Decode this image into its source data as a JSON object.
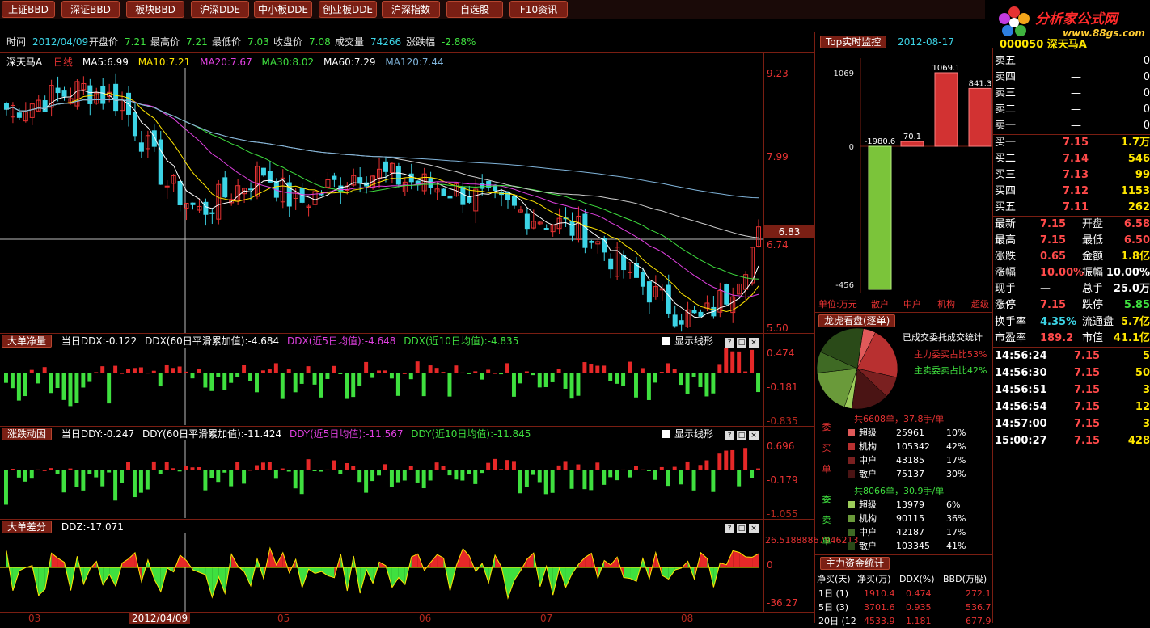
{
  "toolbar": {
    "buttons": [
      "上证BBD",
      "深证BBD",
      "板块BBD",
      "沪深DDE",
      "中小板DDE",
      "创业板DDE",
      "沪深指数",
      "自选股",
      "F10资讯"
    ]
  },
  "logo": {
    "title": "分析家公式网",
    "url": "www.88gs.com"
  },
  "info": {
    "time_label": "时间",
    "time": "2012/04/09",
    "open_label": "开盘价",
    "open": "7.21",
    "high_label": "最高价",
    "high": "7.21",
    "low_label": "最低价",
    "low": "7.03",
    "close_label": "收盘价",
    "close": "7.08",
    "volume_label": "成交量",
    "volume": "74266",
    "change_label": "涨跌幅",
    "change": "-2.88%"
  },
  "kline": {
    "name": "深天马A",
    "period": "日线",
    "ma5": "MA5:6.99",
    "ma10": "MA10:7.21",
    "ma20": "MA20:7.67",
    "ma30": "MA30:8.02",
    "ma60": "MA60:7.29",
    "ma120": "MA120:7.44",
    "axis": [
      "9.23",
      "7.99",
      "6.74",
      "5.50"
    ],
    "current_price": "6.83",
    "colors": {
      "ma5": "#ffffff",
      "ma10": "#ffe600",
      "ma20": "#e040e0",
      "ma30": "#3fe03f",
      "ma60": "#cccccc",
      "ma120": "#7fb3d9",
      "up": "#e63232",
      "down": "#3cd4e6"
    }
  },
  "ddx": {
    "tag": "大单净量",
    "today": "当日DDX:-0.122",
    "acc": "DDX(60日平滑累加值):-4.684",
    "ma5": "DDX(近5日均值):-4.648",
    "ma10": "DDX(近10日均值):-4.835",
    "show": "显示线形",
    "axis": [
      "0.474",
      "-0.181",
      "-0.835"
    ]
  },
  "ddy": {
    "tag": "涨跌动因",
    "today": "当日DDY:-0.247",
    "acc": "DDY(60日平滑累加值):-11.424",
    "ma5": "DDY(近5日均值):-11.567",
    "ma10": "DDY(近10日均值):-11.845",
    "show": "显示线形",
    "axis": [
      "0.696",
      "-0.179",
      "-1.055"
    ]
  },
  "ddz": {
    "tag": "大单差分",
    "today": "DDZ:-17.071",
    "axis_top": "26.51888867946213",
    "axis_mid": "0",
    "axis_bot": "-36.27"
  },
  "xaxis": {
    "labels": [
      "03",
      "2012/04/09",
      "05",
      "06",
      "07",
      "08"
    ]
  },
  "top_monitor": {
    "tag": "Top实时监控",
    "date": "2012-08-17",
    "ytop": "1069",
    "yzero": "0",
    "ybot": "-456",
    "bars": [
      {
        "label": "散户",
        "value": -1980.6
      },
      {
        "label": "中户",
        "value": 70.1
      },
      {
        "label": "机构",
        "value": 1069.1
      },
      {
        "label": "超级",
        "value": 841.3
      }
    ],
    "unit": "单位:万元"
  },
  "lhb": {
    "tag": "龙虎看盘(逐单)",
    "title": "已成交委托成交统计",
    "buy_ratio": "主力委买占比53%",
    "sell_ratio": "主卖委卖占比42%",
    "buy_side": "委买单",
    "sell_side": "委卖单",
    "buy_total": "共6608单，37.8手/单",
    "sell_total": "共8066单，30.9手/单",
    "buy_rows": [
      {
        "name": "超级",
        "count": "25961",
        "pct": "10%"
      },
      {
        "name": "机构",
        "count": "105342",
        "pct": "42%"
      },
      {
        "name": "中户",
        "count": "43185",
        "pct": "17%"
      },
      {
        "name": "散户",
        "count": "75137",
        "pct": "30%"
      }
    ],
    "sell_rows": [
      {
        "name": "超级",
        "count": "13979",
        "pct": "6%"
      },
      {
        "name": "机构",
        "count": "90115",
        "pct": "36%"
      },
      {
        "name": "中户",
        "count": "42187",
        "pct": "17%"
      },
      {
        "name": "散户",
        "count": "103345",
        "pct": "41%"
      }
    ]
  },
  "capital": {
    "tag": "主力资金统计",
    "headers": [
      "净买(天)",
      "净买(万)",
      "DDX(%)",
      "BBD(万股)"
    ],
    "rows": [
      [
        "1日 (1)",
        "1910.4",
        "0.474",
        "272.1"
      ],
      [
        "5日 (3)",
        "3701.6",
        "0.935",
        "536.7"
      ],
      [
        "20日 (12",
        "4533.9",
        "1.181",
        "677.9"
      ]
    ]
  },
  "quote": {
    "header": "000050 深天马A",
    "sell": [
      {
        "label": "卖五",
        "price": "—",
        "vol": "0"
      },
      {
        "label": "卖四",
        "price": "—",
        "vol": "0"
      },
      {
        "label": "卖三",
        "price": "—",
        "vol": "0"
      },
      {
        "label": "卖二",
        "price": "—",
        "vol": "0"
      },
      {
        "label": "卖一",
        "price": "—",
        "vol": "0"
      }
    ],
    "buy": [
      {
        "label": "买一",
        "price": "7.15",
        "vol": "1.7万"
      },
      {
        "label": "买二",
        "price": "7.14",
        "vol": "546"
      },
      {
        "label": "买三",
        "price": "7.13",
        "vol": "99"
      },
      {
        "label": "买四",
        "price": "7.12",
        "vol": "1153"
      },
      {
        "label": "买五",
        "price": "7.11",
        "vol": "262"
      }
    ],
    "stats": [
      {
        "l1": "最新",
        "v1": "7.15",
        "l2": "开盘",
        "v2": "6.58"
      },
      {
        "l1": "最高",
        "v1": "7.15",
        "l2": "最低",
        "v2": "6.50"
      },
      {
        "l1": "涨跌",
        "v1": "0.65",
        "l2": "金额",
        "v2": "1.8亿"
      },
      {
        "l1": "涨幅",
        "v1": "10.00%",
        "l2": "振幅",
        "v2": "10.00%"
      },
      {
        "l1": "现手",
        "v1": "—",
        "l2": "总手",
        "v2": "25.0万"
      },
      {
        "l1": "涨停",
        "v1": "7.15",
        "l2": "跌停",
        "v2": "5.85"
      },
      {
        "l1": "换手率",
        "v1": "4.35%",
        "l2": "流通盘",
        "v2": "5.7亿"
      },
      {
        "l1": "市盈率",
        "v1": "189.2",
        "l2": "市值",
        "v2": "41.1亿"
      }
    ],
    "ticks": [
      {
        "time": "14:56:24",
        "price": "7.15",
        "vol": "5"
      },
      {
        "time": "14:56:30",
        "price": "7.15",
        "vol": "50"
      },
      {
        "time": "14:56:51",
        "price": "7.15",
        "vol": "3"
      },
      {
        "time": "14:56:54",
        "price": "7.15",
        "vol": "12"
      },
      {
        "time": "14:57:00",
        "price": "7.15",
        "vol": "3"
      },
      {
        "time": "15:00:27",
        "price": "7.15",
        "vol": "428"
      }
    ]
  }
}
